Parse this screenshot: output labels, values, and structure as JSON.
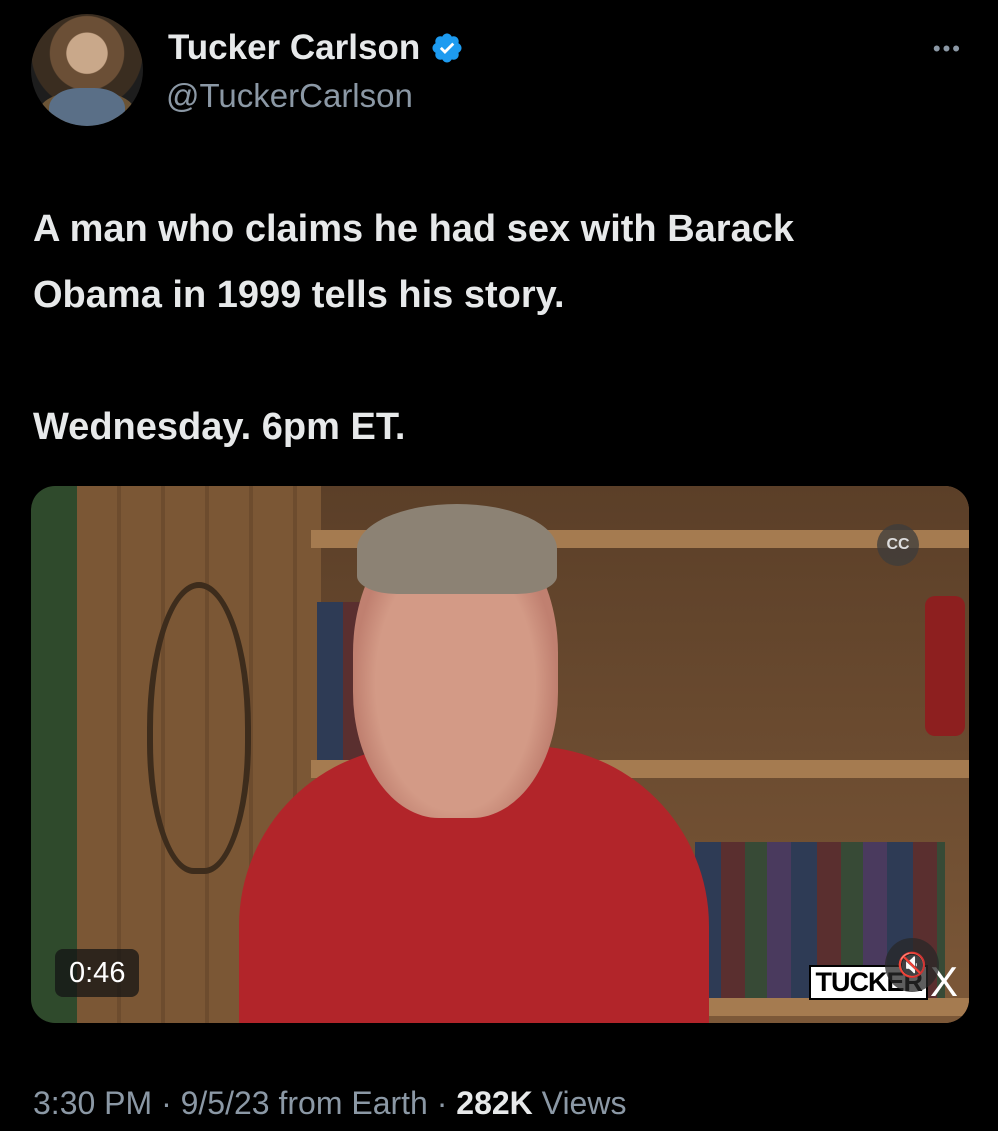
{
  "author": {
    "name": "Tucker Carlson",
    "handle": "@TuckerCarlson",
    "verified": true,
    "verified_color": "#1d9bf0"
  },
  "more_label": "•••",
  "tweet": {
    "text": "A man who claims he had sex with Barack\nObama in 1999 tells his story.\n\nWednesday. 6pm ET."
  },
  "video": {
    "duration": "0:46",
    "cc_label": "CC",
    "mute_icon": "🔇",
    "brand_word": "TUCKER",
    "brand_x": "X"
  },
  "meta": {
    "time": "3:30 PM",
    "sep1": " · ",
    "date": "9/5/23",
    "source": " from Earth",
    "sep2": " · ",
    "views_count": "282K",
    "views_label": " Views"
  }
}
